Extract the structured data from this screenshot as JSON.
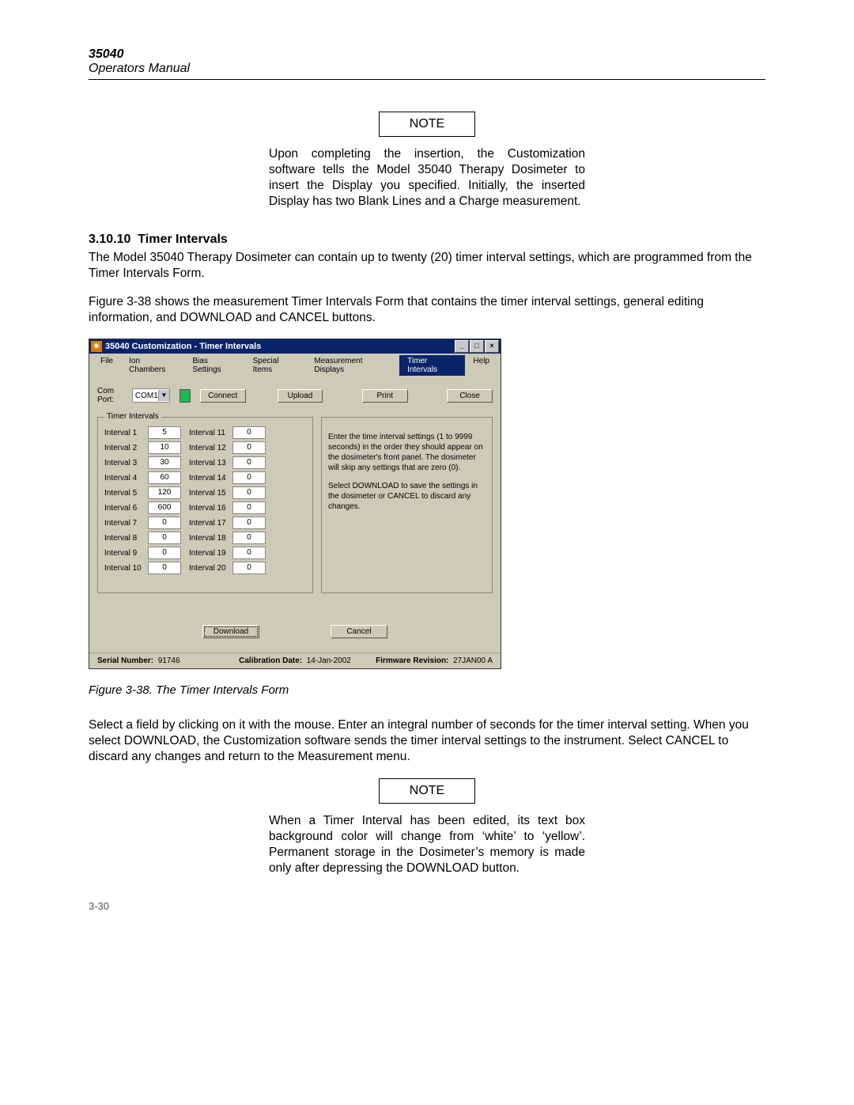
{
  "header": {
    "model": "35040",
    "manual": "Operators Manual"
  },
  "note_label": "NOTE",
  "note1": "Upon completing the insertion, the Customization software tells the Model 35040 Therapy Dosimeter to insert the Display you specified.  Initially, the inserted Display has two Blank Lines and a Charge measurement.",
  "section": {
    "number": "3.10.10",
    "title": "Timer Intervals"
  },
  "para1": "The Model 35040 Therapy Dosimeter can contain up to twenty (20) timer interval settings, which are programmed from the Timer Intervals Form.",
  "para2": "Figure 3-38 shows the measurement Timer Intervals Form that contains the timer interval settings, general editing information, and DOWNLOAD and CANCEL buttons.",
  "caption": "Figure 3-38.      The Timer Intervals Form",
  "para3": "Select a field by clicking on it with the mouse.  Enter an integral number of seconds for the timer interval setting.  When you select DOWNLOAD, the Customization software sends the timer interval settings to the instrument.  Select CANCEL to discard any changes and return to the Measurement menu.",
  "note2": "When a Timer Interval has been edited, its text box background color will change from ‘white’ to ‘yellow’.  Permanent storage in the Dosimeter’s memory is made only after depressing the DOWNLOAD button.",
  "page_num": "3-30",
  "window": {
    "title": "35040 Customization   -   Timer Intervals",
    "menu": [
      "File",
      "Ion Chambers",
      "Bias Settings",
      "Special Items",
      "Measurement Displays",
      "Timer Intervals",
      "Help"
    ],
    "active_menu": "Timer Intervals",
    "comport_label": "Com Port:",
    "comport_value": "COM1",
    "buttons": {
      "connect": "Connect",
      "upload": "Upload",
      "print": "Print",
      "close": "Close",
      "download": "Download",
      "cancel": "Cancel"
    },
    "group_legend": "Timer Intervals",
    "intervals_left": [
      {
        "label": "Interval 1",
        "value": "5"
      },
      {
        "label": "Interval 2",
        "value": "10"
      },
      {
        "label": "Interval 3",
        "value": "30"
      },
      {
        "label": "Interval 4",
        "value": "60"
      },
      {
        "label": "Interval 5",
        "value": "120"
      },
      {
        "label": "Interval 6",
        "value": "600"
      },
      {
        "label": "Interval 7",
        "value": "0"
      },
      {
        "label": "Interval 8",
        "value": "0"
      },
      {
        "label": "Interval 9",
        "value": "0"
      },
      {
        "label": "Interval 10",
        "value": "0"
      }
    ],
    "intervals_right": [
      {
        "label": "Interval 11",
        "value": "0"
      },
      {
        "label": "Interval 12",
        "value": "0"
      },
      {
        "label": "Interval 13",
        "value": "0"
      },
      {
        "label": "Interval 14",
        "value": "0"
      },
      {
        "label": "Interval 15",
        "value": "0"
      },
      {
        "label": "Interval 16",
        "value": "0"
      },
      {
        "label": "Interval 17",
        "value": "0"
      },
      {
        "label": "Interval 18",
        "value": "0"
      },
      {
        "label": "Interval 19",
        "value": "0"
      },
      {
        "label": "Interval 20",
        "value": "0"
      }
    ],
    "info1": "Enter the time interval settings (1 to 9999 seconds) in the order they should appear on the dosimeter's front panel.  The dosimeter will skip any settings that are zero (0).",
    "info2": "Select DOWNLOAD to save the settings in the dosimeter or CANCEL to discard any changes.",
    "status": {
      "serial_label": "Serial Number:",
      "serial_value": "91746",
      "cal_label": "Calibration Date:",
      "cal_value": "14-Jan-2002",
      "fw_label": "Firmware Revision:",
      "fw_value": "27JAN00 A"
    }
  }
}
